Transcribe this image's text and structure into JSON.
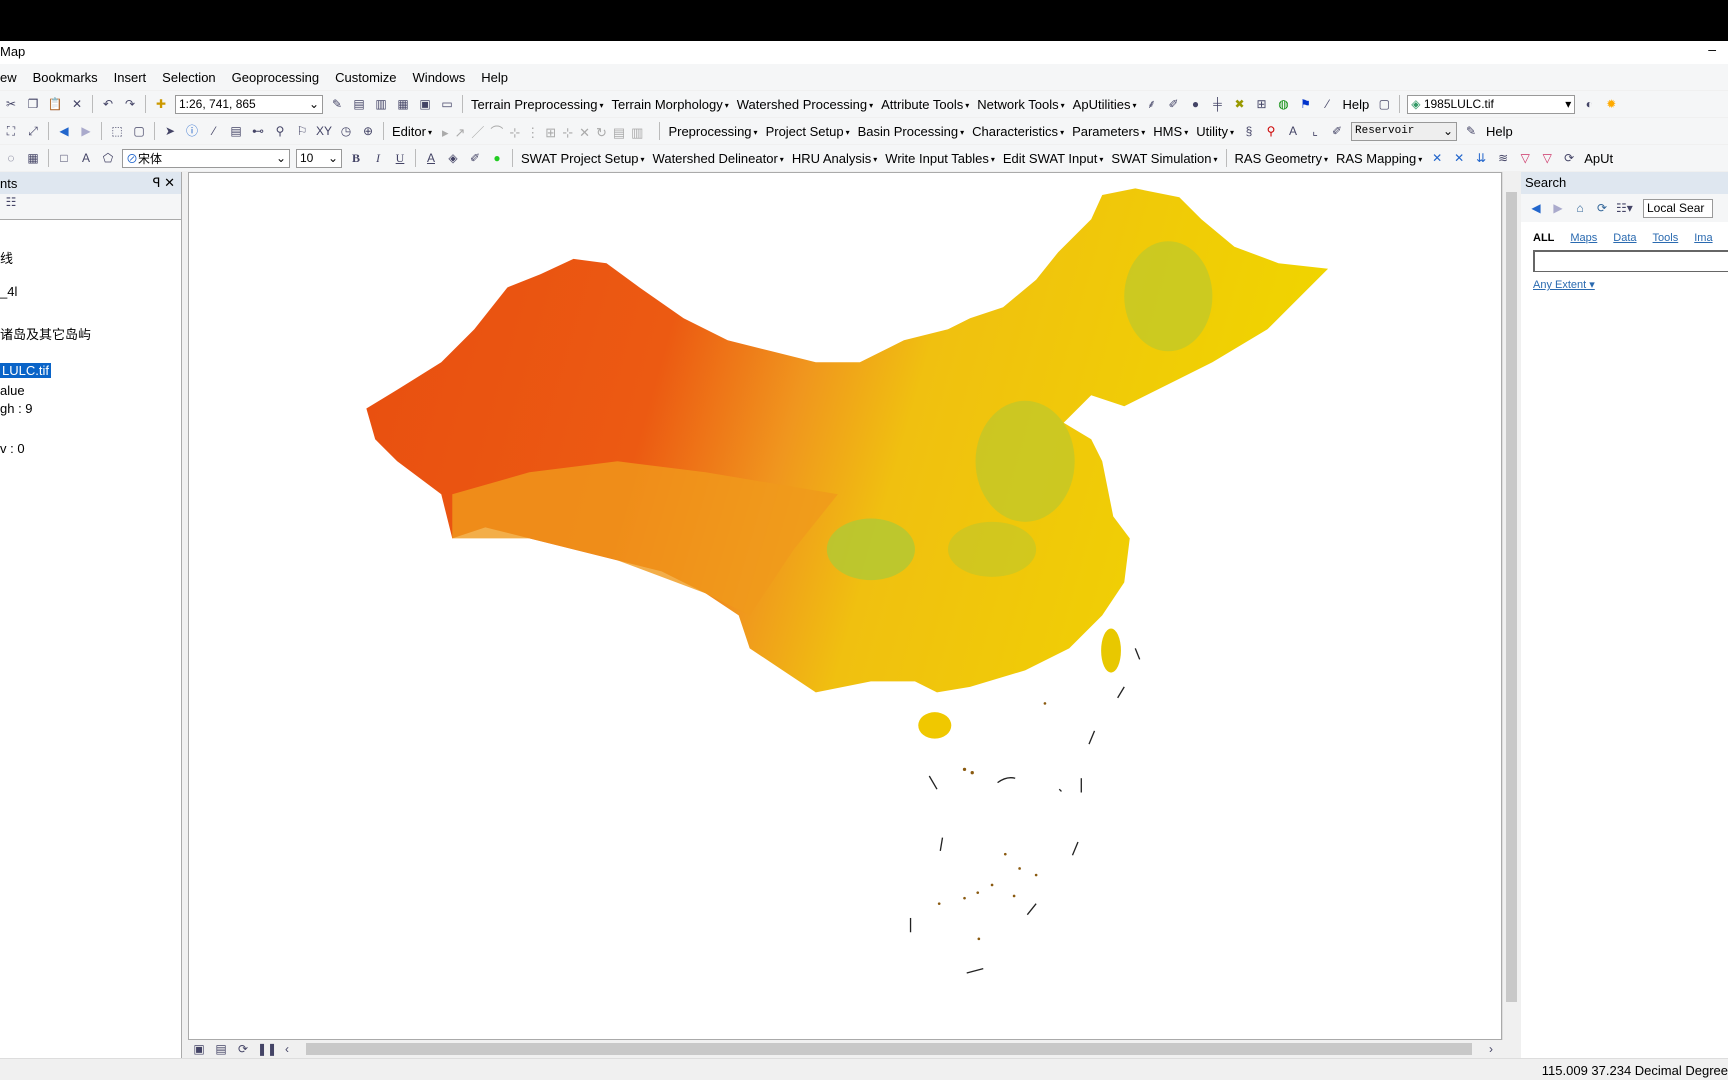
{
  "window": {
    "title": "Map",
    "minimize": "–"
  },
  "menu": [
    "ew",
    "Bookmarks",
    "Insert",
    "Selection",
    "Geoprocessing",
    "Customize",
    "Windows",
    "Help"
  ],
  "toolbar1": {
    "scale": "1:26, 741, 865",
    "menus": [
      "Terrain Preprocessing",
      "Terrain Morphology",
      "Watershed Processing",
      "Attribute Tools",
      "Network Tools",
      "ApUtilities"
    ],
    "help": "Help",
    "layer": "1985LULC.tif"
  },
  "toolbar2": {
    "editor": "Editor",
    "menus": [
      "Preprocessing",
      "Project Setup",
      "Basin Processing",
      "Characteristics",
      "Parameters",
      "HMS",
      "Utility"
    ],
    "reservoir": "Reservoir",
    "help": "Help"
  },
  "toolbar3": {
    "font": "宋体",
    "size": "10",
    "bold": "B",
    "italic": "I",
    "underline": "U",
    "menus": [
      "SWAT Project Setup",
      "Watershed Delineator",
      "HRU Analysis",
      "Write Input Tables",
      "Edit SWAT Input",
      "SWAT Simulation",
      "RAS Geometry",
      "RAS Mapping"
    ],
    "aput": "ApUt"
  },
  "toc": {
    "title": "nts",
    "items": [
      "线",
      "_4l",
      "诸岛及其它岛屿",
      "LULC.tif",
      "alue",
      "gh : 9",
      "v : 0"
    ]
  },
  "search": {
    "title": "Search",
    "local": "Local Sear",
    "tabs": [
      "ALL",
      "Maps",
      "Data",
      "Tools",
      "Ima"
    ],
    "extent": "Any Extent ▾",
    "query": ""
  },
  "status": {
    "coords": "115.009  37.234 Decimal Degree"
  },
  "colors": {
    "west": "#e84e10",
    "mid": "#f0961e",
    "east": "#f0d400",
    "green": "#b4c832"
  }
}
